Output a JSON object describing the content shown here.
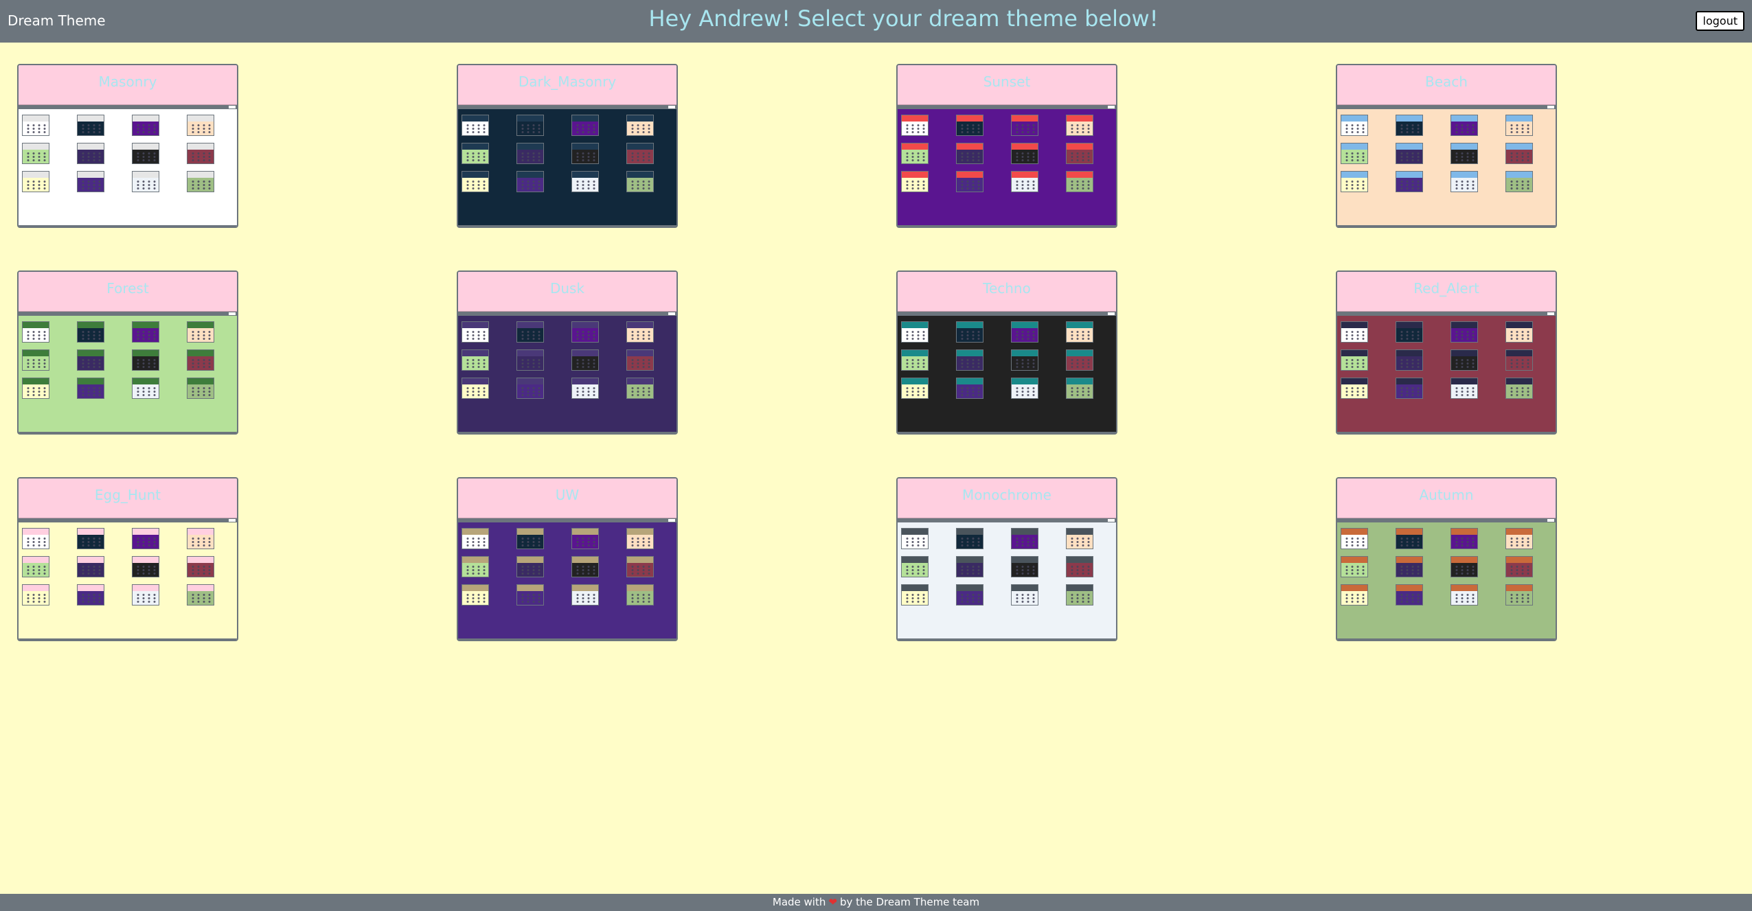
{
  "navbar": {
    "brand": "Dream Theme",
    "greeting": "Hey Andrew! Select your dream theme below!",
    "logout_label": "logout"
  },
  "colors": {
    "page_bg": "#fffdc8",
    "navbar_bg": "#6c757d",
    "card_header_bg": "#ffcfe0",
    "card_title": "#a8e6f0",
    "heart": "#e03131"
  },
  "themes": [
    {
      "name": "Masonry",
      "bg": "#ffffff",
      "header": "#e6e6e6"
    },
    {
      "name": "Dark_Masonry",
      "bg": "#11283b",
      "header": "#1e3a52"
    },
    {
      "name": "Sunset",
      "bg": "#5a1590",
      "header": "#f24a4a"
    },
    {
      "name": "Beach",
      "bg": "#fde0c2",
      "header": "#7fb8e8"
    },
    {
      "name": "Forest",
      "bg": "#b5e199",
      "header": "#3e7d3b"
    },
    {
      "name": "Dusk",
      "bg": "#3a2a63",
      "header": "#4a3878"
    },
    {
      "name": "Techno",
      "bg": "#222222",
      "header": "#1a8a8a"
    },
    {
      "name": "Red_Alert",
      "bg": "#8c3a4c",
      "header": "#2a2a4a"
    },
    {
      "name": "Egg_Hunt",
      "bg": "#fffdc8",
      "header": "#ffcfe0"
    },
    {
      "name": "UW",
      "bg": "#4b2a85",
      "header": "#b7a57a"
    },
    {
      "name": "Monochrome",
      "bg": "#eef3f8",
      "header": "#4a545c"
    },
    {
      "name": "Autumn",
      "bg": "#9fbf85",
      "header": "#c96a3a"
    }
  ],
  "footer": {
    "before": "Made with",
    "heart": "❤",
    "after": "by the Dream Theme team"
  }
}
